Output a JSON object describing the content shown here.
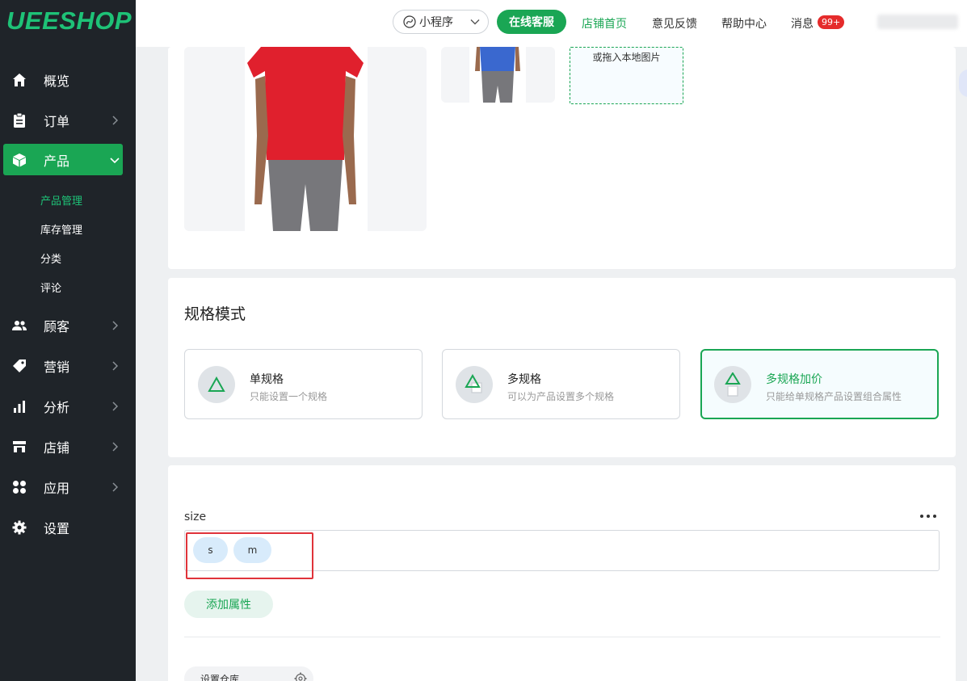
{
  "logo": "UEESHOP",
  "sidebar": {
    "items": [
      {
        "label": "概览"
      },
      {
        "label": "订单"
      },
      {
        "label": "产品"
      },
      {
        "label": "顾客"
      },
      {
        "label": "营销"
      },
      {
        "label": "分析"
      },
      {
        "label": "店铺"
      },
      {
        "label": "应用"
      },
      {
        "label": "设置"
      }
    ],
    "sub_items": [
      {
        "label": "产品管理"
      },
      {
        "label": "库存管理"
      },
      {
        "label": "分类"
      },
      {
        "label": "评论"
      }
    ]
  },
  "topbar": {
    "mini_program": "小程序",
    "service": "在线客服",
    "store_home": "店铺首页",
    "feedback": "意见反馈",
    "help": "帮助中心",
    "messages": "消息",
    "messages_badge": "99+"
  },
  "images": {
    "upload_hint": "或拖入本地图片"
  },
  "spec_mode": {
    "title": "规格模式",
    "options": [
      {
        "title": "单规格",
        "desc": "只能设置一个规格"
      },
      {
        "title": "多规格",
        "desc": "可以为产品设置多个规格"
      },
      {
        "title": "多规格加价",
        "desc": "只能给单规格产品设置组合属性"
      }
    ],
    "selected": "多规格加价"
  },
  "attributes": {
    "name": "size",
    "values": [
      "s",
      "m"
    ],
    "add_button": "添加属性",
    "warehouse_button": "设置仓库"
  },
  "colors": {
    "accent": "#1aa654",
    "sidebar_bg": "#1f2429",
    "shirt_red": "#e0202d",
    "shirt_blue": "#3a68cf",
    "highlight_red": "#e0333a"
  }
}
